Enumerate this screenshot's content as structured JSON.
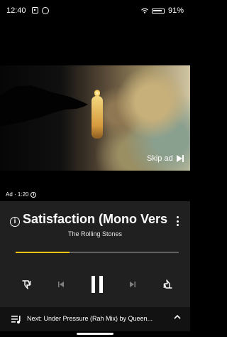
{
  "status_bar": {
    "time": "12:40",
    "battery": "91%"
  },
  "video": {
    "skip_ad_label": "Skip ad",
    "ad_time": "Ad · 1:20"
  },
  "player": {
    "title": "Satisfaction (Mono Vers",
    "artist": "The Rolling Stones",
    "progress": 0.33
  },
  "next": {
    "text": "Next: Under Pressure (Rah Mix) by Queen..."
  },
  "icons": {
    "status_left": [
      "app-notification-icon",
      "sync-icon"
    ],
    "status_right": [
      "wifi-icon",
      "battery-icon"
    ],
    "info": "info-icon",
    "more": "more-vert-icon",
    "controls": [
      "dislike-icon",
      "previous-icon",
      "pause-icon",
      "next-icon",
      "like-icon"
    ],
    "next_queue": "queue-icon",
    "next_chevron": "chevron-up-icon"
  },
  "colors": {
    "accent": "#f1c40f",
    "panel": "#202020",
    "background": "#000000"
  }
}
